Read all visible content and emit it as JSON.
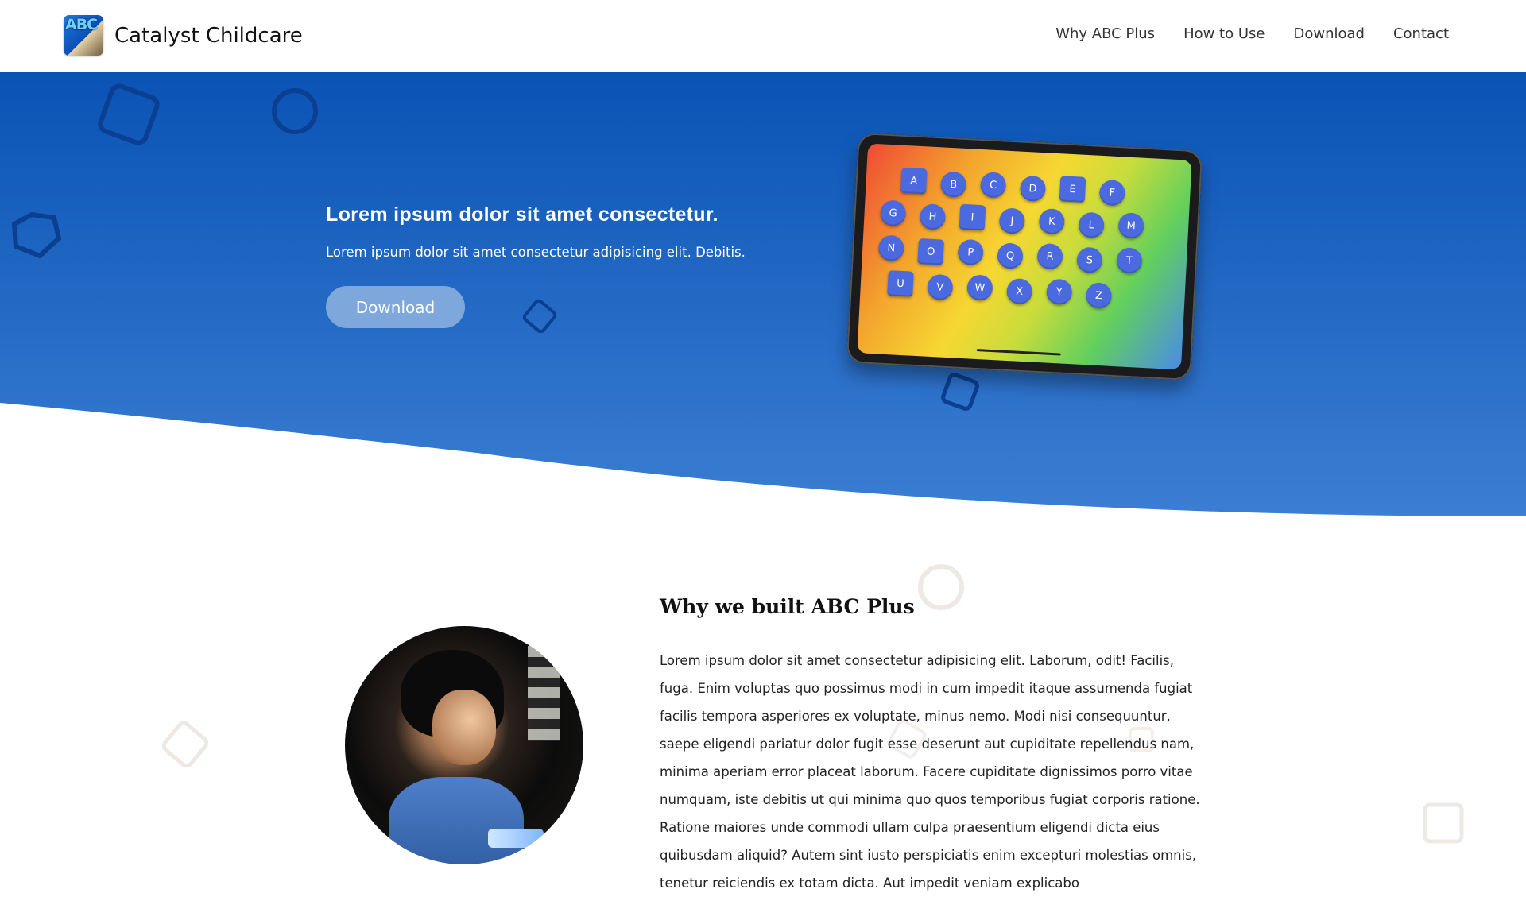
{
  "brand": {
    "logo_text": "ABC",
    "name": "Catalyst Childcare"
  },
  "nav": {
    "items": [
      {
        "label": "Why ABC Plus"
      },
      {
        "label": "How to Use"
      },
      {
        "label": "Download"
      },
      {
        "label": "Contact"
      }
    ]
  },
  "hero": {
    "title": "Lorem ipsum dolor sit amet consectetur.",
    "subtitle": "Lorem ipsum dolor sit amet consectetur adipisicing elit. Debitis.",
    "button_label": "Download"
  },
  "tablet": {
    "keys": [
      {
        "letter": "A",
        "shape": "square"
      },
      {
        "letter": "B",
        "shape": "round"
      },
      {
        "letter": "C",
        "shape": "round"
      },
      {
        "letter": "D",
        "shape": "round"
      },
      {
        "letter": "E",
        "shape": "square"
      },
      {
        "letter": "F",
        "shape": "round"
      },
      {
        "letter": "G",
        "shape": "round"
      },
      {
        "letter": "H",
        "shape": "round"
      },
      {
        "letter": "I",
        "shape": "square"
      },
      {
        "letter": "J",
        "shape": "round"
      },
      {
        "letter": "K",
        "shape": "round"
      },
      {
        "letter": "L",
        "shape": "round"
      },
      {
        "letter": "M",
        "shape": "round"
      },
      {
        "letter": "N",
        "shape": "round"
      },
      {
        "letter": "O",
        "shape": "square"
      },
      {
        "letter": "P",
        "shape": "round"
      },
      {
        "letter": "Q",
        "shape": "round"
      },
      {
        "letter": "R",
        "shape": "round"
      },
      {
        "letter": "S",
        "shape": "round"
      },
      {
        "letter": "T",
        "shape": "round"
      },
      {
        "letter": "U",
        "shape": "square"
      },
      {
        "letter": "V",
        "shape": "round"
      },
      {
        "letter": "W",
        "shape": "round"
      },
      {
        "letter": "X",
        "shape": "round"
      },
      {
        "letter": "Y",
        "shape": "round"
      },
      {
        "letter": "Z",
        "shape": "round"
      }
    ]
  },
  "about": {
    "title": "Why we built ABC Plus",
    "body": "Lorem ipsum dolor sit amet consectetur adipisicing elit. Laborum, odit! Facilis, fuga. Enim voluptas quo possimus modi in cum impedit itaque assumenda fugiat facilis tempora asperiores ex voluptate, minus nemo. Modi nisi consequuntur, saepe eligendi pariatur dolor fugit esse deserunt aut cupiditate repellendus nam, minima aperiam error placeat laborum. Facere cupiditate dignissimos porro vitae numquam, iste debitis ut qui minima quo quos temporibus fugiat corporis ratione. Ratione maiores unde commodi ullam culpa praesentium eligendi dicta eius quibusdam aliquid? Autem sint iusto perspiciatis enim excepturi molestias omnis, tenetur reiciendis ex totam dicta. Aut impedit veniam explicabo"
  },
  "colors": {
    "hero_top": "#0a53b5",
    "hero_bottom": "#3b7ed3",
    "button_bg": "#7ea8dc",
    "key_bg": "#4b6ae0"
  }
}
